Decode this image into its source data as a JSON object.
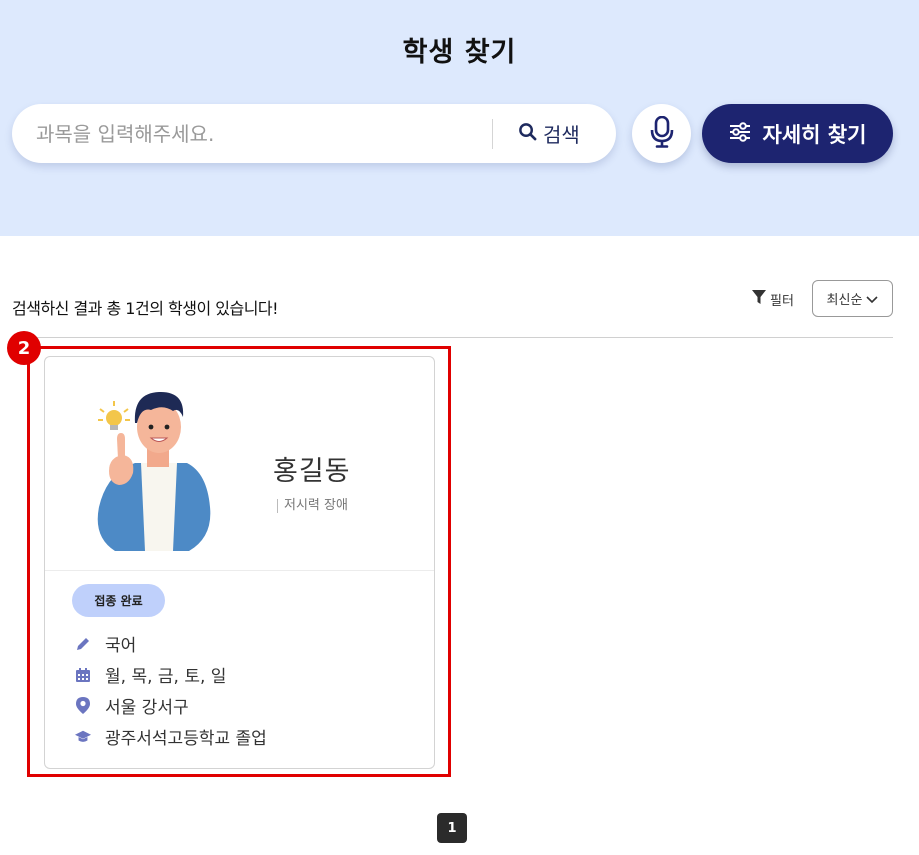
{
  "header": {
    "title": "학생 찾기"
  },
  "search": {
    "placeholder": "과목을 입력해주세요.",
    "value": "",
    "button_label": "검색",
    "mic_icon": "microphone-icon",
    "advanced_label": "자세히 찾기",
    "advanced_icon": "sliders-icon"
  },
  "results": {
    "summary": "검색하신 결과 총 1건의 학생이 있습니다!",
    "filter_label": "필터",
    "sort_label": "최신순"
  },
  "annotation": {
    "number": "2",
    "color": "#e00000"
  },
  "cards": [
    {
      "name": "홍길동",
      "disability": "저시력 장애",
      "status": "접종 완료",
      "subject": "국어",
      "days": "월, 목, 금, 토, 일",
      "location": "서울 강서구",
      "education": "광주서석고등학교 졸업"
    }
  ],
  "pagination": {
    "current": "1"
  },
  "colors": {
    "hero_bg": "#dde9fd",
    "primary": "#1d2470",
    "badge_bg": "#bfd0fb",
    "icon": "#6b75c0"
  }
}
